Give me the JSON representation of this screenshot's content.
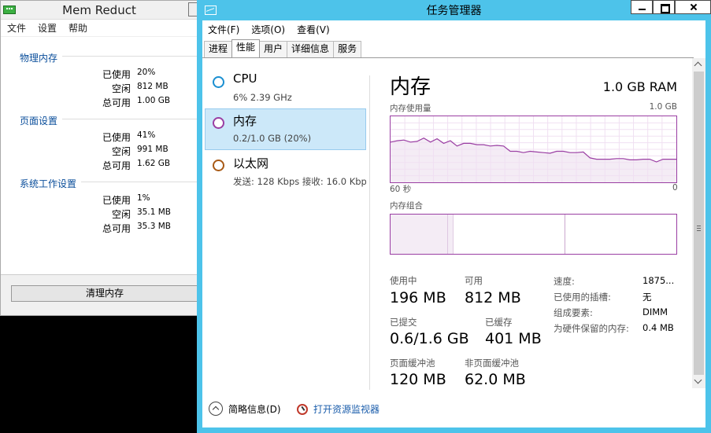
{
  "memreduct": {
    "title": "Mem Reduct",
    "menu": [
      "文件",
      "设置",
      "帮助"
    ],
    "groups": [
      {
        "name": "物理内存",
        "rows": [
          {
            "label": "已使用",
            "value": "20%"
          },
          {
            "label": "空闲",
            "value": "812 MB"
          },
          {
            "label": "总可用",
            "value": "1.00 GB"
          }
        ]
      },
      {
        "name": "页面设置",
        "rows": [
          {
            "label": "已使用",
            "value": "41%"
          },
          {
            "label": "空闲",
            "value": "991 MB"
          },
          {
            "label": "总可用",
            "value": "1.62 GB"
          }
        ]
      },
      {
        "name": "系统工作设置",
        "rows": [
          {
            "label": "已使用",
            "value": "1%"
          },
          {
            "label": "空闲",
            "value": "35.1 MB"
          },
          {
            "label": "总可用",
            "value": "35.3 MB"
          }
        ]
      }
    ],
    "clean_button": "清理内存"
  },
  "taskmgr": {
    "title": "任务管理器",
    "menu": [
      "文件(F)",
      "选项(O)",
      "查看(V)"
    ],
    "tabs": [
      {
        "label": "进程"
      },
      {
        "label": "性能",
        "active": true
      },
      {
        "label": "用户"
      },
      {
        "label": "详细信息"
      },
      {
        "label": "服务"
      }
    ],
    "resources": [
      {
        "name": "CPU",
        "sub": "6% 2.39 GHz",
        "color": "#1a8fd1"
      },
      {
        "name": "内存",
        "sub": "0.2/1.0 GB (20%)",
        "color": "#9a3ea3",
        "selected": true
      },
      {
        "name": "以太网",
        "sub": "发送: 128 Kbps 接收: 16.0 Kbps",
        "color": "#a85a16"
      }
    ],
    "detail": {
      "title": "内存",
      "ram": "1.0 GB RAM",
      "usage_label": "内存使用量",
      "usage_max": "1.0 GB",
      "time_left": "60 秒",
      "time_right": "0",
      "composition_label": "内存组合",
      "usage_history": [
        0.33,
        0.35,
        0.36,
        0.33,
        0.34,
        0.39,
        0.33,
        0.38,
        0.31,
        0.35,
        0.27,
        0.31,
        0.31,
        0.29,
        0.29,
        0.27,
        0.28,
        0.27,
        0.19,
        0.19,
        0.17,
        0.19,
        0.18,
        0.17,
        0.16,
        0.19,
        0.19,
        0.17,
        0.17,
        0.18,
        0.09,
        0.07,
        0.07,
        0.07,
        0.08,
        0.08,
        0.06,
        0.06,
        0.07,
        0.07,
        0.03,
        0.07,
        0.07,
        0.07
      ],
      "composition": {
        "in_use": 0.2,
        "modified": 0.02,
        "standby": 0.39
      },
      "stats": [
        {
          "label": "使用中",
          "value": "196 MB"
        },
        {
          "label": "可用",
          "value": "812 MB"
        },
        {
          "label": "已提交",
          "value": "0.6/1.6 GB"
        },
        {
          "label": "已缓存",
          "value": "401 MB"
        },
        {
          "label": "页面缓冲池",
          "value": "120 MB"
        },
        {
          "label": "非页面缓冲池",
          "value": "62.0 MB"
        }
      ],
      "properties": [
        {
          "label": "速度:",
          "value": "1875..."
        },
        {
          "label": "已使用的插槽:",
          "value": "无"
        },
        {
          "label": "组成要素:",
          "value": "DIMM"
        },
        {
          "label": "为硬件保留的内存:",
          "value": "0.4 MB"
        }
      ]
    },
    "footer": {
      "fewer_details": "简略信息(D)",
      "resource_monitor": "打开资源监视器"
    }
  }
}
